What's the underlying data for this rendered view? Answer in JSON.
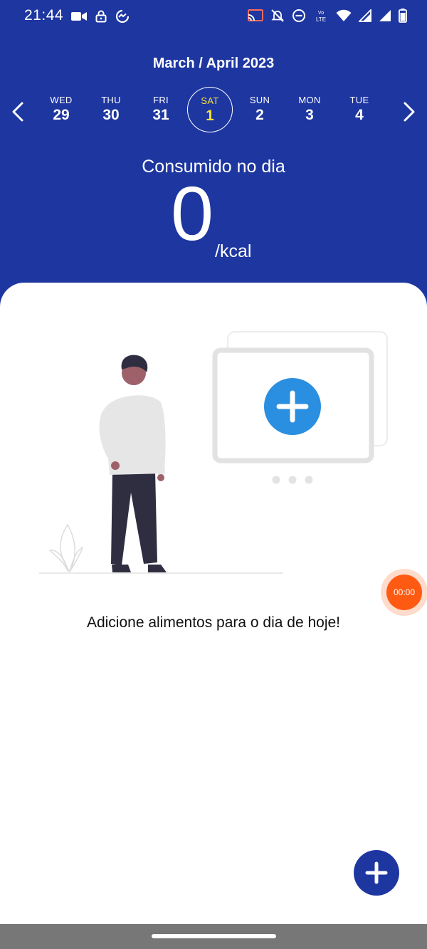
{
  "status_bar": {
    "time": "21:44",
    "left_icons": [
      "video-camera-icon",
      "lock-icon",
      "messenger-icon"
    ],
    "right_icons": [
      "cast-icon",
      "bell-off-icon",
      "do-not-disturb-icon",
      "volte-icon",
      "wifi-icon",
      "signal-icon",
      "signal-icon",
      "battery-icon"
    ],
    "volte_text": "LTE"
  },
  "header": {
    "month_title": "March / April 2023",
    "prev_icon": "chevron-left-icon",
    "next_icon": "chevron-right-icon"
  },
  "days": [
    {
      "dow": "WED",
      "num": "29",
      "selected": false
    },
    {
      "dow": "THU",
      "num": "30",
      "selected": false
    },
    {
      "dow": "FRI",
      "num": "31",
      "selected": false
    },
    {
      "dow": "SAT",
      "num": "1",
      "selected": true
    },
    {
      "dow": "SUN",
      "num": "2",
      "selected": false
    },
    {
      "dow": "MON",
      "num": "3",
      "selected": false
    },
    {
      "dow": "TUE",
      "num": "4",
      "selected": false
    }
  ],
  "consumption": {
    "label": "Consumido no dia",
    "value": "0",
    "unit": "/kcal"
  },
  "content": {
    "empty_message": "Adicione alimentos para o dia de hoje!",
    "timer": "00:00",
    "fab_icon": "plus-icon"
  },
  "colors": {
    "primary": "#1e36a0",
    "selected_day": "#f5e33a",
    "accent_blue": "#2a8fe0",
    "timer_orange": "#ff5a12"
  }
}
